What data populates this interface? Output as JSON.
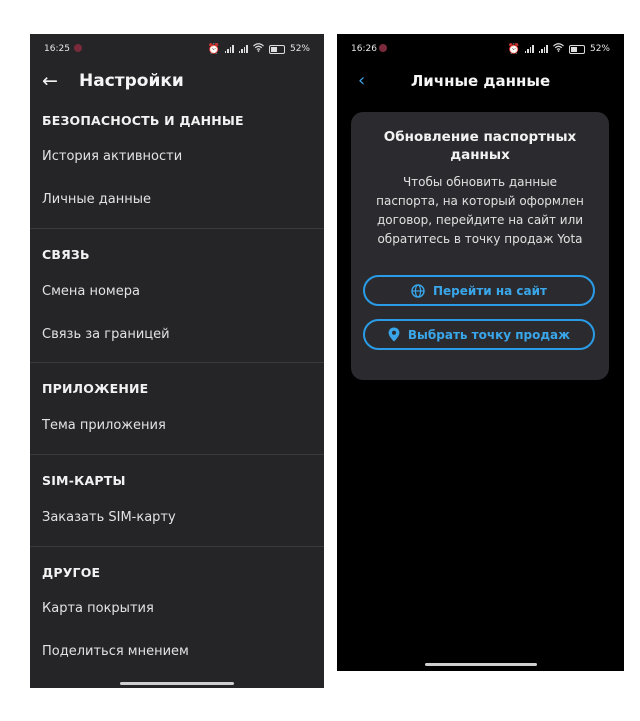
{
  "left_phone": {
    "status": {
      "time": "16:25",
      "battery": "52%"
    },
    "header": {
      "title": "Настройки"
    },
    "sections": [
      {
        "title": "БЕЗОПАСНОСТЬ И ДАННЫЕ",
        "items": [
          "История активности",
          "Личные данные"
        ]
      },
      {
        "title": "СВЯЗЬ",
        "items": [
          "Смена номера",
          "Связь за границей"
        ]
      },
      {
        "title": "ПРИЛОЖЕНИЕ",
        "items": [
          "Тема приложения"
        ]
      },
      {
        "title": "SIM-КАРТЫ",
        "items": [
          "Заказать SIM-карту"
        ]
      },
      {
        "title": "ДРУГОЕ",
        "items": [
          "Карта покрытия",
          "Поделиться мнением"
        ]
      }
    ]
  },
  "right_phone": {
    "status": {
      "time": "16:26",
      "battery": "52%"
    },
    "header": {
      "title": "Личные данные"
    },
    "card": {
      "title_line1": "Обновление паспортных",
      "title_line2": "данных",
      "text_line1": "Чтобы обновить данные",
      "text_line2": "паспорта, на который оформлен",
      "text_line3": "договор, перейдите на сайт или",
      "text_line4": "обратитесь в точку продаж Yota",
      "button_site": "Перейти на сайт",
      "button_store": "Выбрать точку продаж"
    }
  },
  "colors": {
    "accent": "#2a9be6",
    "left_bg": "#252528",
    "right_bg": "#000000",
    "card_bg": "#2b2b2f"
  }
}
